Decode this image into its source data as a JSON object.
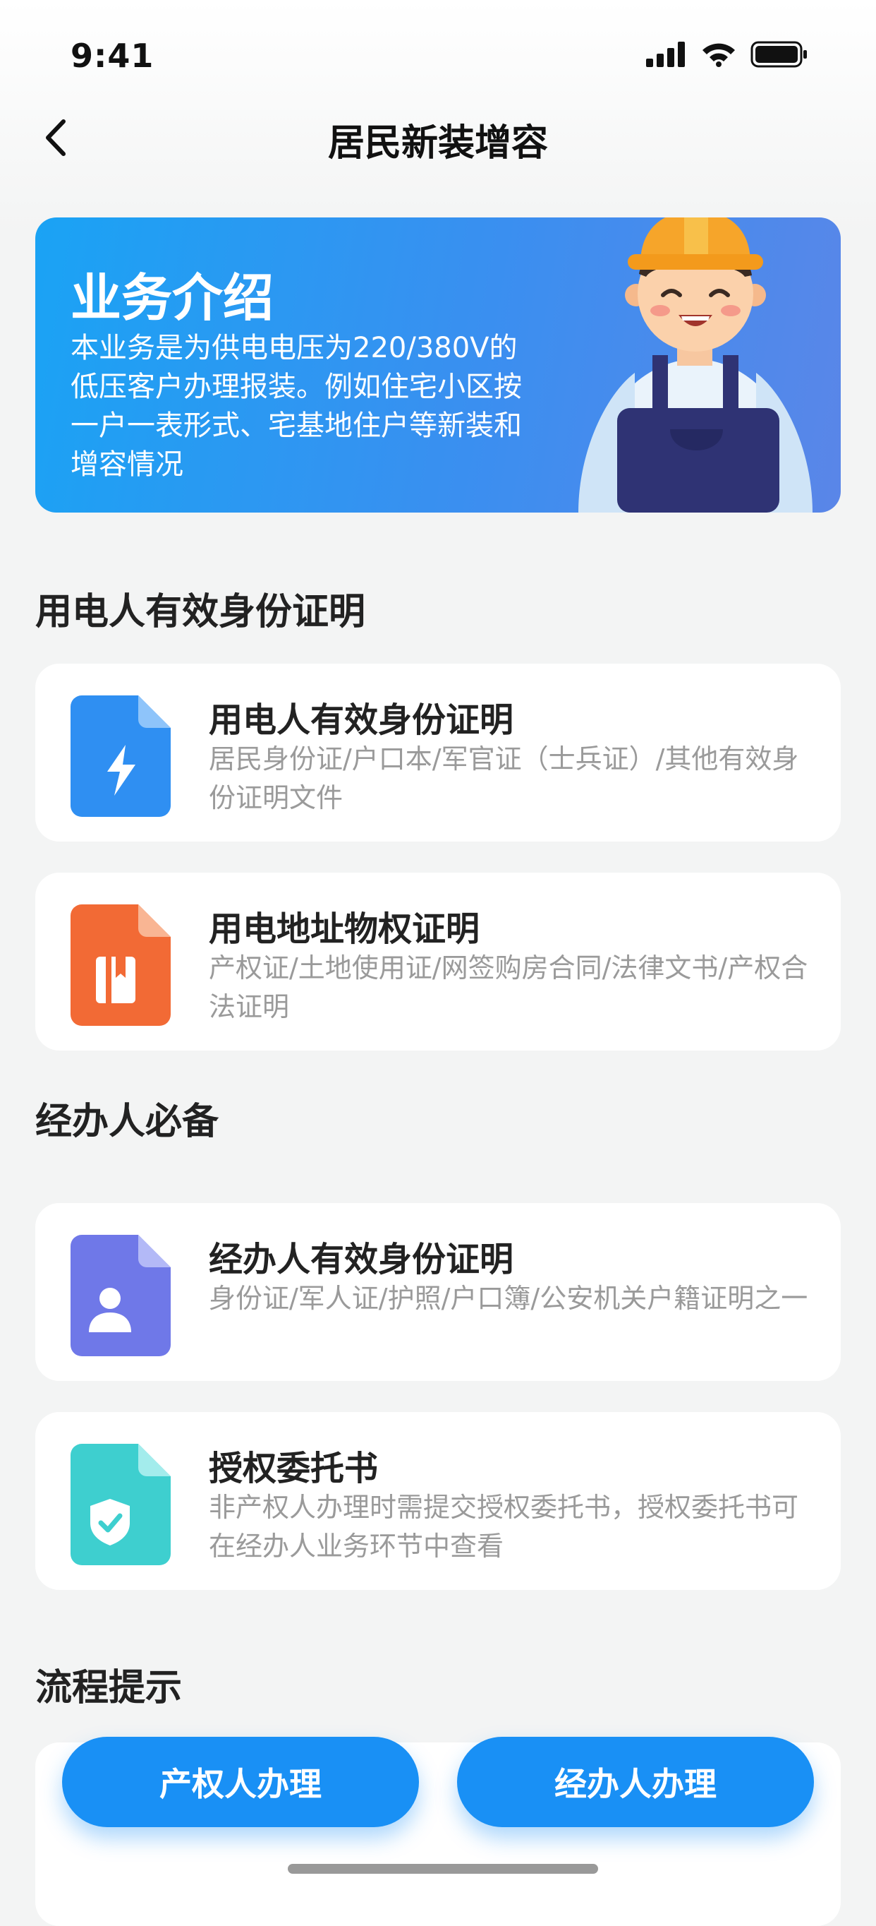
{
  "status_bar": {
    "time": "9:41"
  },
  "nav": {
    "title": "居民新装增容",
    "back_icon": "chevron-left-icon"
  },
  "banner": {
    "title": "业务介绍",
    "description": "本业务是为供电电压为220/380V的低压客户办理报装。例如住宅小区按一户一表形式、宅基地住户等新装和增容情况",
    "background_color": "#2a9bf2"
  },
  "sections": [
    {
      "title": "用电人有效身份证明",
      "cards": [
        {
          "title": "用电人有效身份证明",
          "description": "居民身份证/户口本/军官证（士兵证）/其他有效身份证明文件",
          "icon": "lightning-document-icon",
          "color": "#2f8ff2"
        },
        {
          "title": "用电地址物权证明",
          "description": "产权证/土地使用证/网签购房合同/法律文书/产权合法证明",
          "icon": "book-document-icon",
          "color": "#f26a35"
        }
      ]
    },
    {
      "title": "经办人必备",
      "cards": [
        {
          "title": "经办人有效身份证明",
          "description": "身份证/军人证/护照/户口簿/公安机关户籍证明之一",
          "icon": "person-document-icon",
          "color": "#6f78e8"
        },
        {
          "title": "授权委托书",
          "description": "非产权人办理时需提交授权委托书，授权委托书可在经办人业务环节中查看",
          "icon": "shield-check-document-icon",
          "color": "#3ecfcf"
        }
      ]
    },
    {
      "title": "流程提示"
    }
  ],
  "buttons": {
    "owner": "产权人办理",
    "agent": "经办人办理",
    "accent": "#1990f5"
  }
}
